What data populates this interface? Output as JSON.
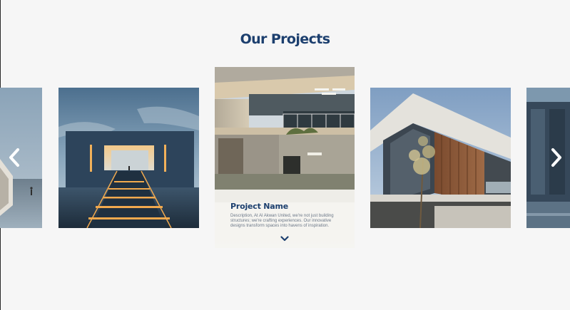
{
  "section": {
    "title": "Our Projects"
  },
  "carousel": {
    "featured": {
      "name": "Project Name",
      "description": "Description, At Al Akwan United, we're not just building structures; we're crafting experiences. Our innovative designs transform spaces into havens of inspiration."
    },
    "prev_icon": "chevron-left-icon",
    "next_icon": "chevron-right-icon",
    "expand_icon": "chevron-down-icon"
  },
  "colors": {
    "page_background": "#f6f6f6",
    "title": "#1c3f6e",
    "description_text": "#6c7888",
    "arrow": "#ffffff"
  }
}
